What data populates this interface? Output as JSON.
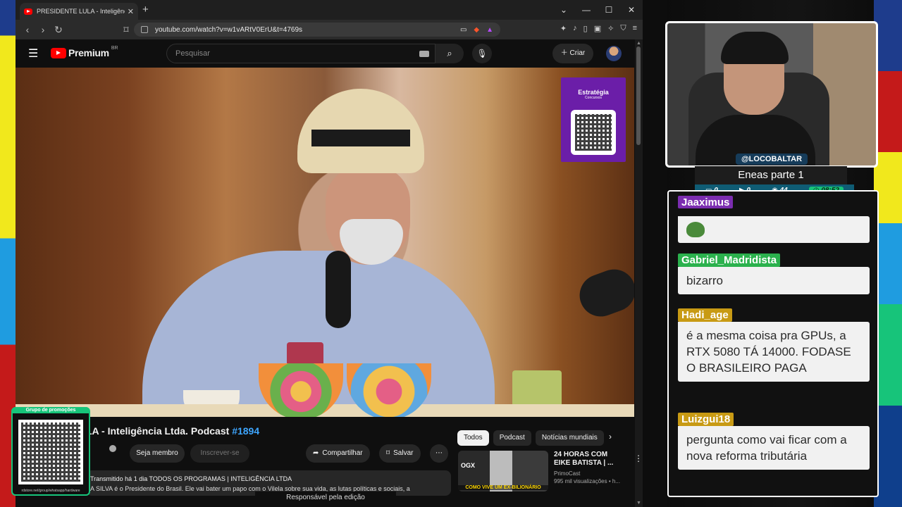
{
  "browser": {
    "tab_title": "PRESIDENTE LULA - Inteligência Ltda. P",
    "tab_close": "✕",
    "new_tab": "+",
    "window_controls": [
      "⌄",
      "—",
      "☐",
      "✕"
    ],
    "url": "youtube.com/watch?v=w1vARtV0ErU&t=4769s"
  },
  "youtube": {
    "logo_word": "Premium",
    "country": "BR",
    "search_placeholder": "Pesquisar",
    "create_label": "Criar",
    "video": {
      "promo_brand": "Estratégia",
      "promo_sub": "Concursos",
      "title_prefix": "LA - Inteligência Ltda. Podcast ",
      "title_tag": "#1894",
      "member_label": "Seja membro",
      "subscribe_label": "Inscrever-se",
      "share_label": "Compartilhar",
      "save_label": "Salvar",
      "desc_meta": "Transmitido há 1 dia  TODOS OS PROGRAMAS | INTELIGÊNCIA LTDA",
      "desc_line": "A SILVA é o Presidente do Brasil. Ele vai bater um papo com o Vilela sobre sua vida, as lutas políticas e sociais, a"
    },
    "chips": [
      "Todos",
      "Podcast",
      "Notícias mundiais"
    ],
    "recommended": {
      "thumb_badge": "OGX",
      "thumb_caption": "COMO VIVE UM EX-BILIONÁRIO",
      "title": "24 HORAS COM EIKE BATISTA | ...",
      "channel": "PrimoCast",
      "views": "995 mil visualizações • h..."
    },
    "status": "Responsável pela edição"
  },
  "overlay": {
    "qr_label": "Grupo de promoções",
    "qr_url": "rdstore.net/group/whatsapp/hardware",
    "handle": "@LOCOBALTAR",
    "game_title": "Eneas parte 1",
    "stats": [
      "0",
      "0",
      "44",
      "08:52"
    ]
  },
  "chat": [
    {
      "user": "Jaaximus",
      "text": ""
    },
    {
      "user": "Gabriel_Madridista",
      "text": "bizarro"
    },
    {
      "user": "Hadi_age",
      "text": "é a mesma coisa pra GPUs, a RTX 5080 TÁ 14000. FODASE O BRASILEIRO PAGA"
    },
    {
      "user": "Luizgui18",
      "text": "pergunta como vai ficar com a nova reforma tributária"
    }
  ]
}
